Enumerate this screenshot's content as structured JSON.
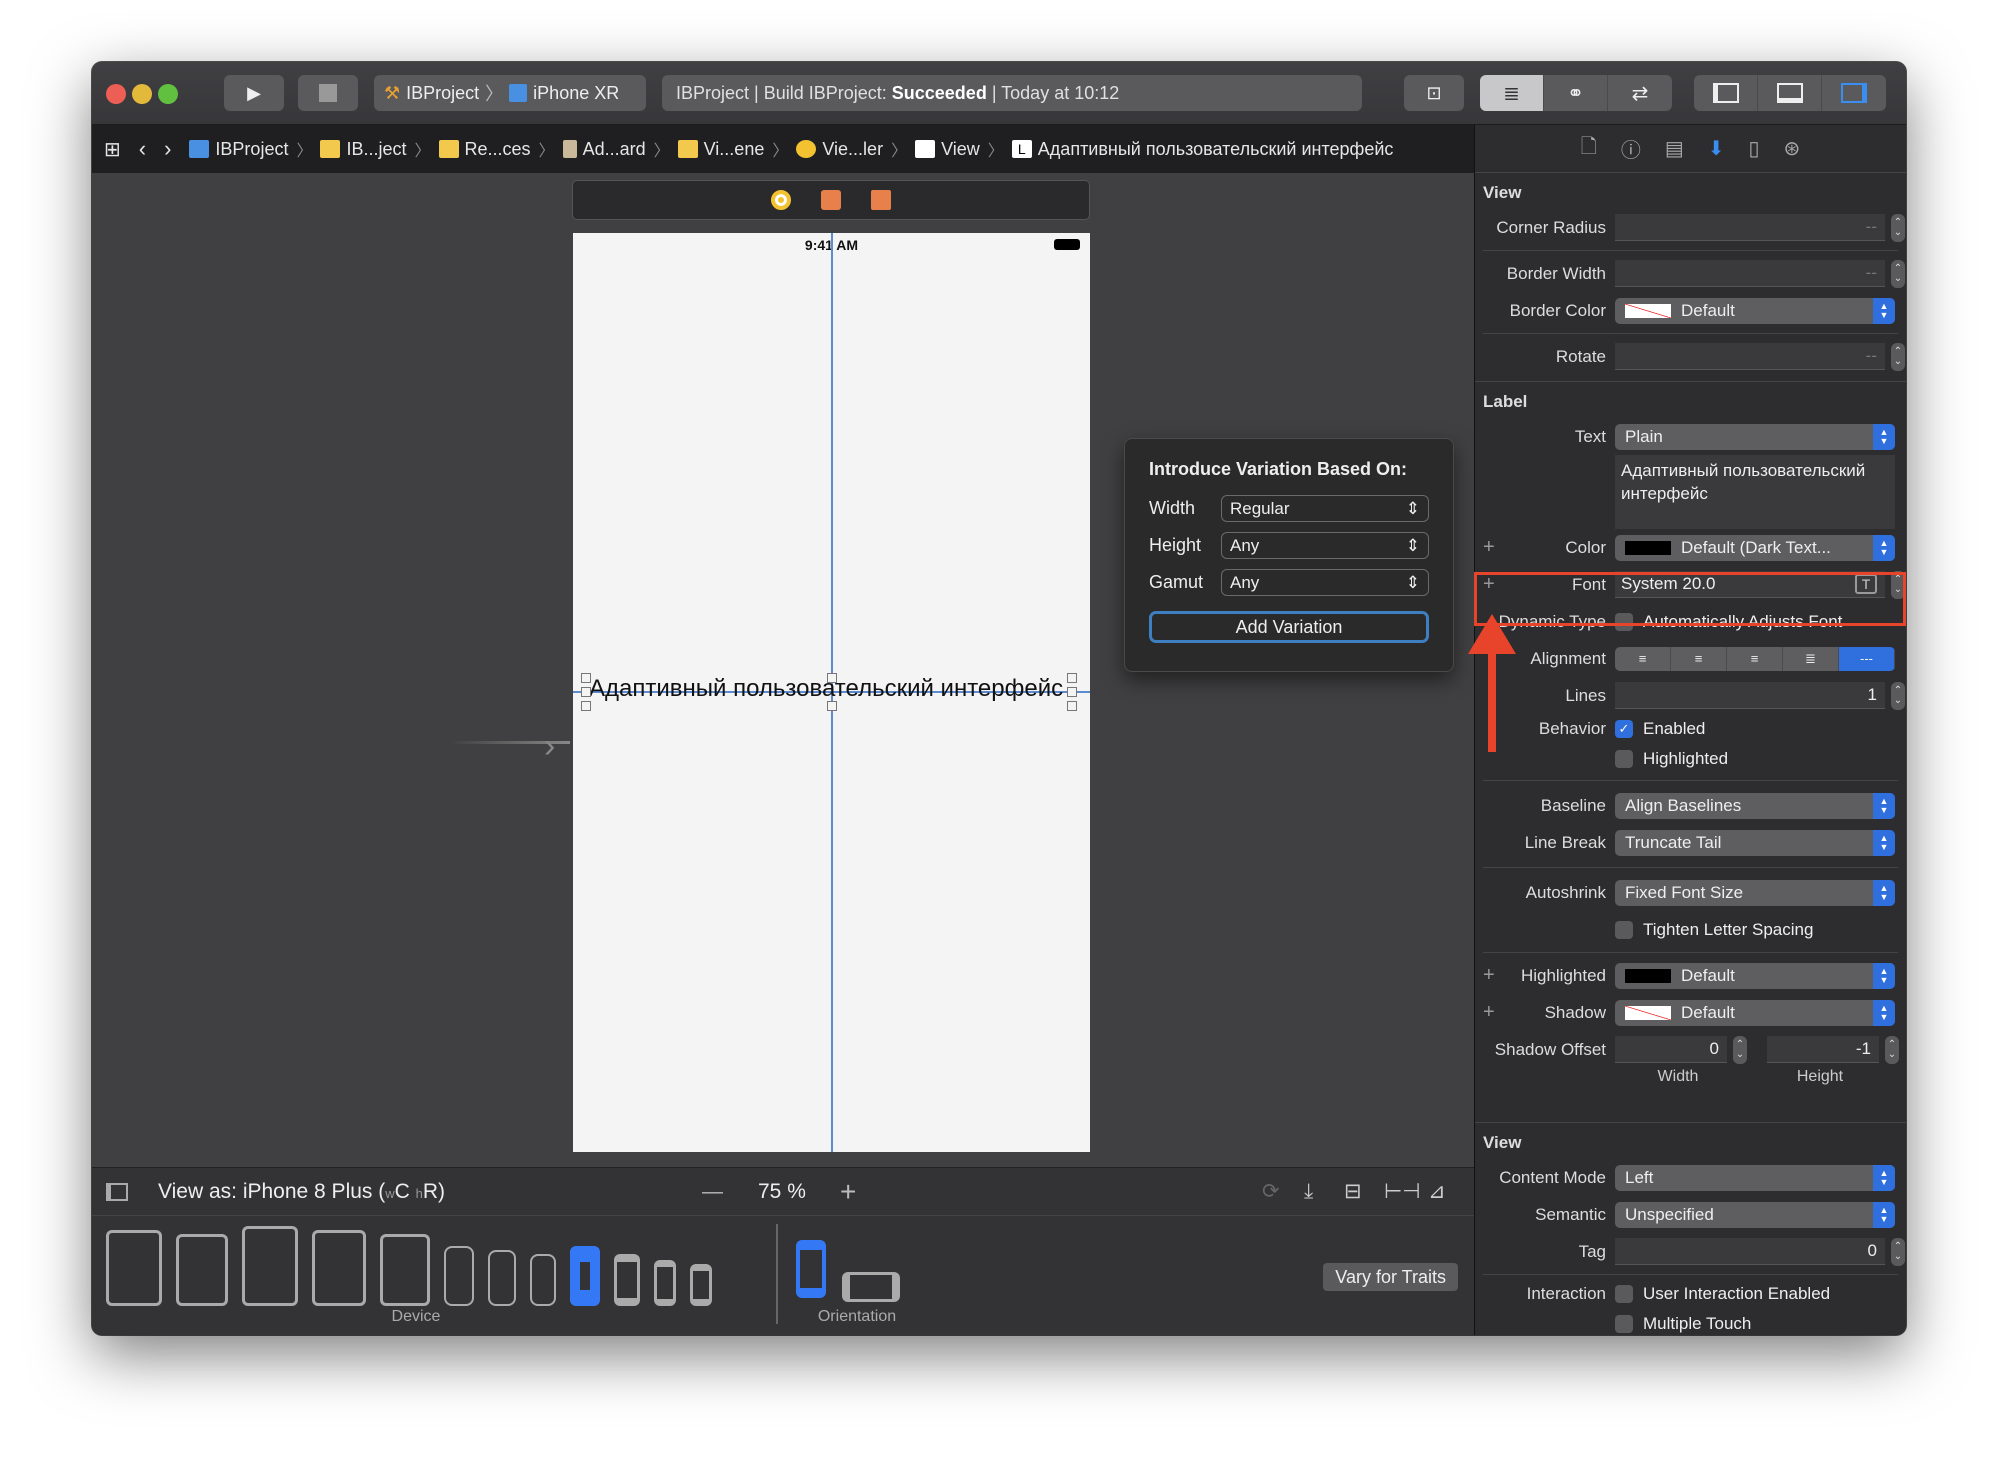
{
  "toolbar": {
    "scheme_project": "IBProject",
    "scheme_device": "iPhone XR",
    "status_prefix": "IBProject | Build IBProject:",
    "status_result": "Succeeded",
    "status_time": "| Today at 10:12"
  },
  "breadcrumb": [
    {
      "label": "IBProject",
      "icon": "project-file-icon"
    },
    {
      "label": "IB...ject",
      "icon": "folder-icon"
    },
    {
      "label": "Re...ces",
      "icon": "folder-icon"
    },
    {
      "label": "Ad...ard",
      "icon": "storyboard-icon"
    },
    {
      "label": "Vi...ene",
      "icon": "scene-icon"
    },
    {
      "label": "Vie...ler",
      "icon": "view-controller-icon"
    },
    {
      "label": "View",
      "icon": "view-icon"
    },
    {
      "label": "Адаптивный пользовательский интерфейс",
      "icon": "label-icon"
    }
  ],
  "canvas": {
    "status_time": "9:41 AM",
    "label_text": "Адаптивный пользовательский интерфейс"
  },
  "popover": {
    "title": "Introduce Variation Based On:",
    "width_label": "Width",
    "width_value": "Regular",
    "height_label": "Height",
    "height_value": "Any",
    "gamut_label": "Gamut",
    "gamut_value": "Any",
    "add_button": "Add Variation"
  },
  "bottom": {
    "view_as": "View as: iPhone 8 Plus (",
    "w_small": "w",
    "w_class": "C",
    "h_small": "h",
    "h_class": "R)",
    "zoom_minus": "—",
    "zoom": "75 %",
    "zoom_plus": "+",
    "device_label": "Device",
    "orientation_label": "Orientation",
    "vary_button": "Vary for Traits"
  },
  "inspector": {
    "view_section": {
      "title": "View",
      "corner_radius_label": "Corner Radius",
      "corner_radius_value": "--",
      "border_width_label": "Border Width",
      "border_width_value": "--",
      "border_color_label": "Border Color",
      "border_color_value": "Default",
      "rotate_label": "Rotate",
      "rotate_value": "--"
    },
    "label_section": {
      "title": "Label",
      "text_label": "Text",
      "text_value": "Plain",
      "text_content": "Адаптивный пользовательский интерфейс",
      "color_label": "Color",
      "color_value": "Default (Dark Text...",
      "font_label": "Font",
      "font_value": "System 20.0",
      "dynamic_type_label": "Dynamic Type",
      "dynamic_type_value": "Automatically Adjusts Font",
      "alignment_label": "Alignment",
      "lines_label": "Lines",
      "lines_value": "1",
      "behavior_label": "Behavior",
      "enabled_label": "Enabled",
      "enabled_checked": true,
      "highlighted_label": "Highlighted",
      "baseline_label": "Baseline",
      "baseline_value": "Align Baselines",
      "line_break_label": "Line Break",
      "line_break_value": "Truncate Tail",
      "autoshrink_label": "Autoshrink",
      "autoshrink_value": "Fixed Font Size",
      "tighten_label": "Tighten Letter Spacing",
      "highlighted_color_label": "Highlighted",
      "highlighted_color_value": "Default",
      "shadow_label": "Shadow",
      "shadow_value": "Default",
      "shadow_offset_label": "Shadow Offset",
      "shadow_offset_width": "0",
      "shadow_offset_height": "-1",
      "width_caption": "Width",
      "height_caption": "Height"
    },
    "view_section2": {
      "title": "View",
      "content_mode_label": "Content Mode",
      "content_mode_value": "Left",
      "semantic_label": "Semantic",
      "semantic_value": "Unspecified",
      "tag_label": "Tag",
      "tag_value": "0",
      "interaction_label": "Interaction",
      "user_interaction_label": "User Interaction Enabled",
      "multiple_touch_label": "Multiple Touch"
    }
  },
  "colors": {
    "accent": "#2f6fde",
    "highlight_annotation": "#e8442c"
  }
}
